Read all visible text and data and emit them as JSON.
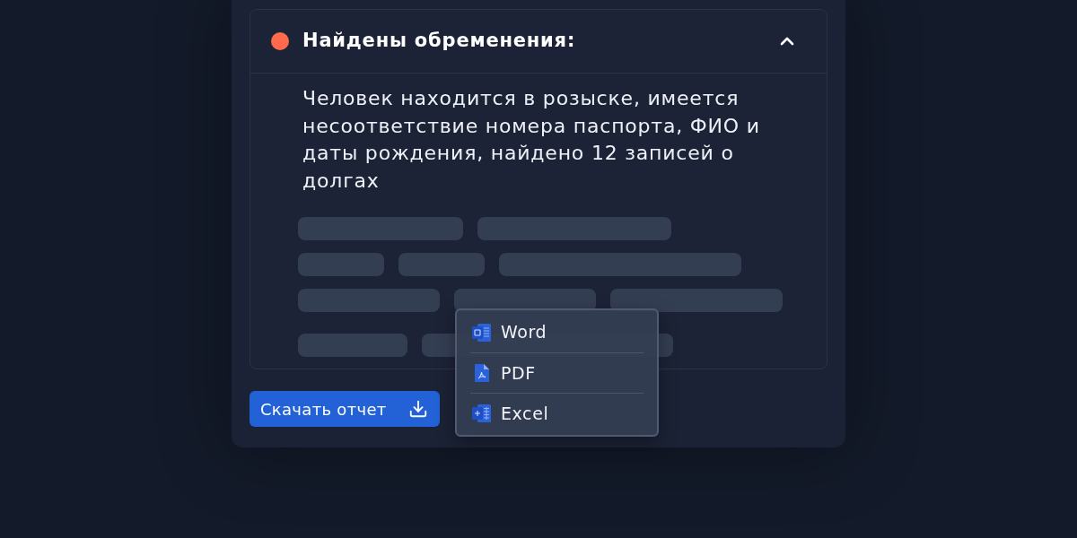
{
  "panel": {
    "title": "Найдены обременения:",
    "color": "#ff6a4d",
    "expanded": true,
    "description": "Человек находится в розыске, имеется несоответствие номера паспорта, ФИО и даты рождения, найдено 12 записей о долгах",
    "loading": true
  },
  "download_button": {
    "label": "Скачать отчет"
  },
  "format_menu": {
    "open": true,
    "items": [
      {
        "kind": "word",
        "label": "Word"
      },
      {
        "kind": "pdf",
        "label": "PDF"
      },
      {
        "kind": "excel",
        "label": "Excel"
      }
    ]
  }
}
